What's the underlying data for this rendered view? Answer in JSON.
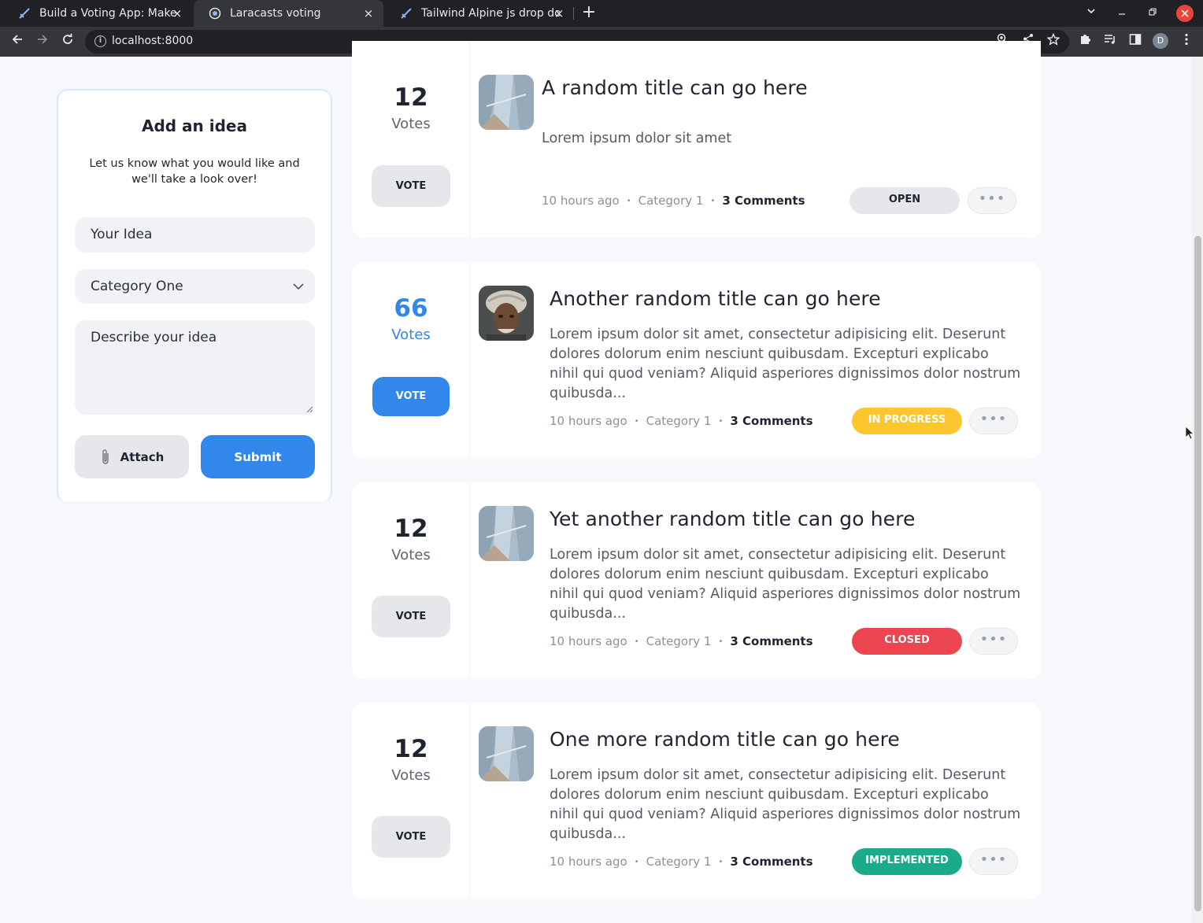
{
  "browser": {
    "tabs": [
      {
        "title": "Build a Voting App: Make",
        "close": "×"
      },
      {
        "title": "Laracasts voting",
        "close": "×"
      },
      {
        "title": "Tailwind Alpine js drop do",
        "close": "×"
      }
    ],
    "new_tab": "+",
    "url": "localhost:8000",
    "profile_initial": "D"
  },
  "add_idea": {
    "title": "Add an idea",
    "subtitle": "Let us know what you would like and we'll take a look over!",
    "idea_placeholder": "Your Idea",
    "category_selected": "Category One",
    "description_placeholder": "Describe your idea",
    "attach_label": "Attach",
    "submit_label": "Submit"
  },
  "ideas": [
    {
      "votes": "12",
      "votes_label": "Votes",
      "vote_button": "VOTE",
      "voted": false,
      "title": "A random title can go here",
      "description": "Lorem ipsum dolor sit amet",
      "time": "10 hours ago",
      "category": "Category 1",
      "comments": "3 Comments",
      "status": "OPEN",
      "status_color": "#e5e7eb",
      "avatar": "image-icon"
    },
    {
      "votes": "66",
      "votes_label": "Votes",
      "vote_button": "VOTE",
      "voted": true,
      "title": "Another random title can go here",
      "description": "Lorem ipsum dolor sit amet, consectetur adipisicing elit. Deserunt dolores dolorum enim nesciunt quibusdam. Excepturi explicabo nihil qui quod veniam? Aliquid asperiores dignissimos dolor nostrum quibusda...",
      "time": "10 hours ago",
      "category": "Category 1",
      "comments": "3 Comments",
      "status": "IN PROGRESS",
      "status_color": "#fcc62e",
      "avatar": "portrait-photo"
    },
    {
      "votes": "12",
      "votes_label": "Votes",
      "vote_button": "VOTE",
      "voted": false,
      "title": "Yet another random title can go here",
      "description": "Lorem ipsum dolor sit amet, consectetur adipisicing elit. Deserunt dolores dolorum enim nesciunt quibusdam. Excepturi explicabo nihil qui quod veniam? Aliquid asperiores dignissimos dolor nostrum quibusda...",
      "time": "10 hours ago",
      "category": "Category 1",
      "comments": "3 Comments",
      "status": "CLOSED",
      "status_color": "#ec454f",
      "avatar": "image-icon"
    },
    {
      "votes": "12",
      "votes_label": "Votes",
      "vote_button": "VOTE",
      "voted": false,
      "title": "One more random title can go here",
      "description": "Lorem ipsum dolor sit amet, consectetur adipisicing elit. Deserunt dolores dolorum enim nesciunt quibusdam. Excepturi explicabo nihil qui quod veniam? Aliquid asperiores dignissimos dolor nostrum quibusda...",
      "time": "10 hours ago",
      "category": "Category 1",
      "comments": "3 Comments",
      "status": "IMPLEMENTED",
      "status_color": "#1aab8b",
      "avatar": "image-icon"
    }
  ],
  "meta_separator": "•",
  "more_label": "•••",
  "colors": {
    "accent": "#3187ea",
    "page_bg": "#f7f8fc"
  }
}
